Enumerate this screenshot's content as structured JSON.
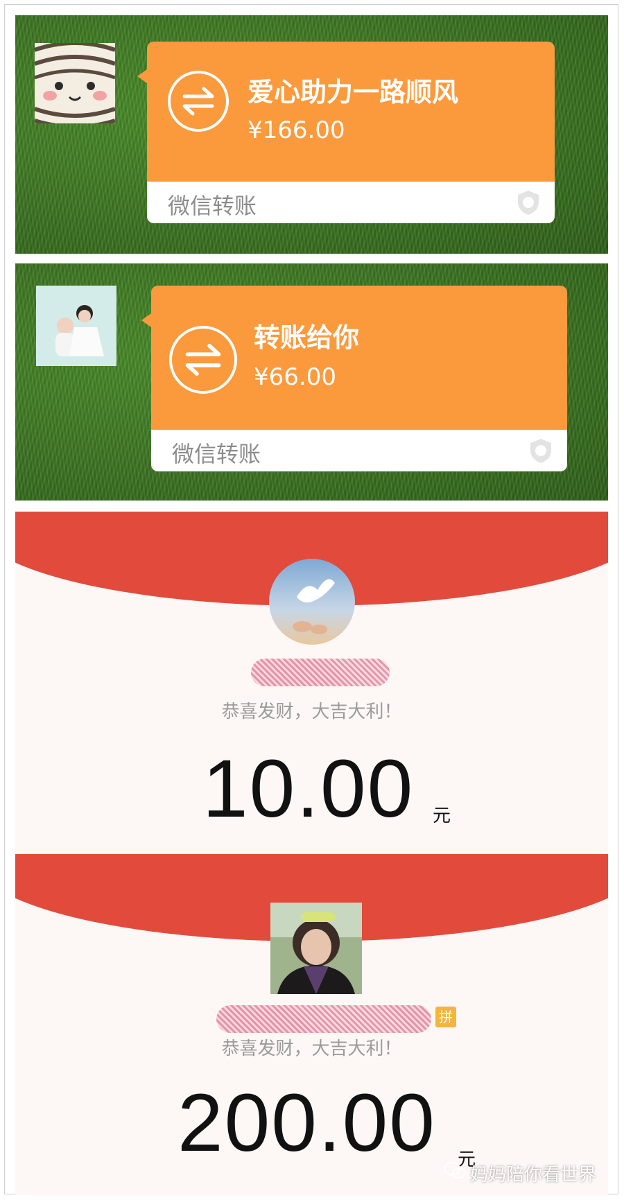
{
  "transfers": [
    {
      "title": "爱心助力一路顺风",
      "amount": "¥166.00",
      "footer": "微信转账"
    },
    {
      "title": "转账给你",
      "amount": "¥66.00",
      "footer": "微信转账"
    }
  ],
  "red_packets": [
    {
      "wish": "恭喜发财，大吉大利！",
      "amount": "10.00",
      "unit": "元"
    },
    {
      "wish": "恭喜发财，大吉大利！",
      "amount": "200.00",
      "unit": "元",
      "badge": "拼"
    }
  ],
  "watermark": "妈妈陪你看世界",
  "colors": {
    "bubble": "#fb9a3d",
    "packet_red": "#e24b3c",
    "grass": "#3f7a25"
  }
}
